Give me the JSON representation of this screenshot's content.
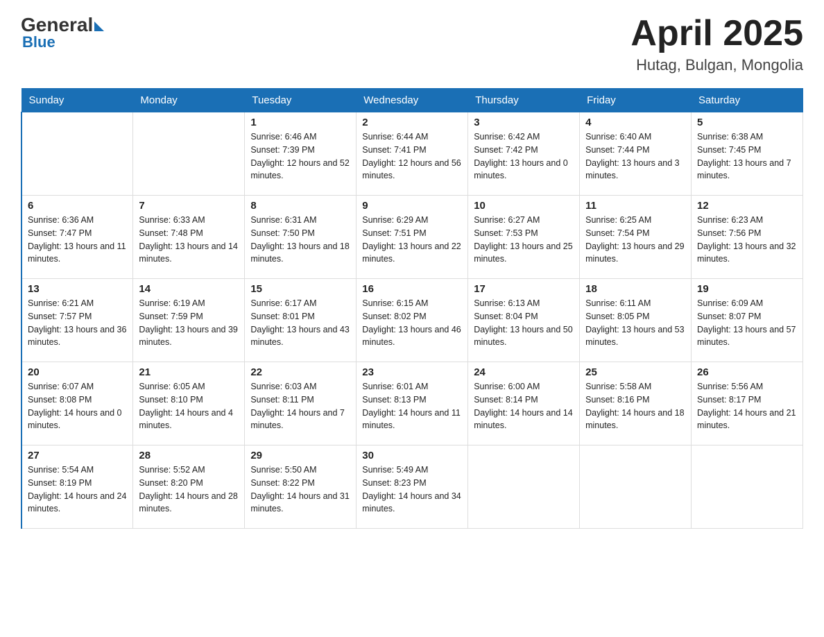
{
  "header": {
    "logo_general": "General",
    "logo_blue": "Blue",
    "month_title": "April 2025",
    "location": "Hutag, Bulgan, Mongolia"
  },
  "days_of_week": [
    "Sunday",
    "Monday",
    "Tuesday",
    "Wednesday",
    "Thursday",
    "Friday",
    "Saturday"
  ],
  "weeks": [
    [
      {
        "day": "",
        "sunrise": "",
        "sunset": "",
        "daylight": ""
      },
      {
        "day": "",
        "sunrise": "",
        "sunset": "",
        "daylight": ""
      },
      {
        "day": "1",
        "sunrise": "Sunrise: 6:46 AM",
        "sunset": "Sunset: 7:39 PM",
        "daylight": "Daylight: 12 hours and 52 minutes."
      },
      {
        "day": "2",
        "sunrise": "Sunrise: 6:44 AM",
        "sunset": "Sunset: 7:41 PM",
        "daylight": "Daylight: 12 hours and 56 minutes."
      },
      {
        "day": "3",
        "sunrise": "Sunrise: 6:42 AM",
        "sunset": "Sunset: 7:42 PM",
        "daylight": "Daylight: 13 hours and 0 minutes."
      },
      {
        "day": "4",
        "sunrise": "Sunrise: 6:40 AM",
        "sunset": "Sunset: 7:44 PM",
        "daylight": "Daylight: 13 hours and 3 minutes."
      },
      {
        "day": "5",
        "sunrise": "Sunrise: 6:38 AM",
        "sunset": "Sunset: 7:45 PM",
        "daylight": "Daylight: 13 hours and 7 minutes."
      }
    ],
    [
      {
        "day": "6",
        "sunrise": "Sunrise: 6:36 AM",
        "sunset": "Sunset: 7:47 PM",
        "daylight": "Daylight: 13 hours and 11 minutes."
      },
      {
        "day": "7",
        "sunrise": "Sunrise: 6:33 AM",
        "sunset": "Sunset: 7:48 PM",
        "daylight": "Daylight: 13 hours and 14 minutes."
      },
      {
        "day": "8",
        "sunrise": "Sunrise: 6:31 AM",
        "sunset": "Sunset: 7:50 PM",
        "daylight": "Daylight: 13 hours and 18 minutes."
      },
      {
        "day": "9",
        "sunrise": "Sunrise: 6:29 AM",
        "sunset": "Sunset: 7:51 PM",
        "daylight": "Daylight: 13 hours and 22 minutes."
      },
      {
        "day": "10",
        "sunrise": "Sunrise: 6:27 AM",
        "sunset": "Sunset: 7:53 PM",
        "daylight": "Daylight: 13 hours and 25 minutes."
      },
      {
        "day": "11",
        "sunrise": "Sunrise: 6:25 AM",
        "sunset": "Sunset: 7:54 PM",
        "daylight": "Daylight: 13 hours and 29 minutes."
      },
      {
        "day": "12",
        "sunrise": "Sunrise: 6:23 AM",
        "sunset": "Sunset: 7:56 PM",
        "daylight": "Daylight: 13 hours and 32 minutes."
      }
    ],
    [
      {
        "day": "13",
        "sunrise": "Sunrise: 6:21 AM",
        "sunset": "Sunset: 7:57 PM",
        "daylight": "Daylight: 13 hours and 36 minutes."
      },
      {
        "day": "14",
        "sunrise": "Sunrise: 6:19 AM",
        "sunset": "Sunset: 7:59 PM",
        "daylight": "Daylight: 13 hours and 39 minutes."
      },
      {
        "day": "15",
        "sunrise": "Sunrise: 6:17 AM",
        "sunset": "Sunset: 8:01 PM",
        "daylight": "Daylight: 13 hours and 43 minutes."
      },
      {
        "day": "16",
        "sunrise": "Sunrise: 6:15 AM",
        "sunset": "Sunset: 8:02 PM",
        "daylight": "Daylight: 13 hours and 46 minutes."
      },
      {
        "day": "17",
        "sunrise": "Sunrise: 6:13 AM",
        "sunset": "Sunset: 8:04 PM",
        "daylight": "Daylight: 13 hours and 50 minutes."
      },
      {
        "day": "18",
        "sunrise": "Sunrise: 6:11 AM",
        "sunset": "Sunset: 8:05 PM",
        "daylight": "Daylight: 13 hours and 53 minutes."
      },
      {
        "day": "19",
        "sunrise": "Sunrise: 6:09 AM",
        "sunset": "Sunset: 8:07 PM",
        "daylight": "Daylight: 13 hours and 57 minutes."
      }
    ],
    [
      {
        "day": "20",
        "sunrise": "Sunrise: 6:07 AM",
        "sunset": "Sunset: 8:08 PM",
        "daylight": "Daylight: 14 hours and 0 minutes."
      },
      {
        "day": "21",
        "sunrise": "Sunrise: 6:05 AM",
        "sunset": "Sunset: 8:10 PM",
        "daylight": "Daylight: 14 hours and 4 minutes."
      },
      {
        "day": "22",
        "sunrise": "Sunrise: 6:03 AM",
        "sunset": "Sunset: 8:11 PM",
        "daylight": "Daylight: 14 hours and 7 minutes."
      },
      {
        "day": "23",
        "sunrise": "Sunrise: 6:01 AM",
        "sunset": "Sunset: 8:13 PM",
        "daylight": "Daylight: 14 hours and 11 minutes."
      },
      {
        "day": "24",
        "sunrise": "Sunrise: 6:00 AM",
        "sunset": "Sunset: 8:14 PM",
        "daylight": "Daylight: 14 hours and 14 minutes."
      },
      {
        "day": "25",
        "sunrise": "Sunrise: 5:58 AM",
        "sunset": "Sunset: 8:16 PM",
        "daylight": "Daylight: 14 hours and 18 minutes."
      },
      {
        "day": "26",
        "sunrise": "Sunrise: 5:56 AM",
        "sunset": "Sunset: 8:17 PM",
        "daylight": "Daylight: 14 hours and 21 minutes."
      }
    ],
    [
      {
        "day": "27",
        "sunrise": "Sunrise: 5:54 AM",
        "sunset": "Sunset: 8:19 PM",
        "daylight": "Daylight: 14 hours and 24 minutes."
      },
      {
        "day": "28",
        "sunrise": "Sunrise: 5:52 AM",
        "sunset": "Sunset: 8:20 PM",
        "daylight": "Daylight: 14 hours and 28 minutes."
      },
      {
        "day": "29",
        "sunrise": "Sunrise: 5:50 AM",
        "sunset": "Sunset: 8:22 PM",
        "daylight": "Daylight: 14 hours and 31 minutes."
      },
      {
        "day": "30",
        "sunrise": "Sunrise: 5:49 AM",
        "sunset": "Sunset: 8:23 PM",
        "daylight": "Daylight: 14 hours and 34 minutes."
      },
      {
        "day": "",
        "sunrise": "",
        "sunset": "",
        "daylight": ""
      },
      {
        "day": "",
        "sunrise": "",
        "sunset": "",
        "daylight": ""
      },
      {
        "day": "",
        "sunrise": "",
        "sunset": "",
        "daylight": ""
      }
    ]
  ]
}
